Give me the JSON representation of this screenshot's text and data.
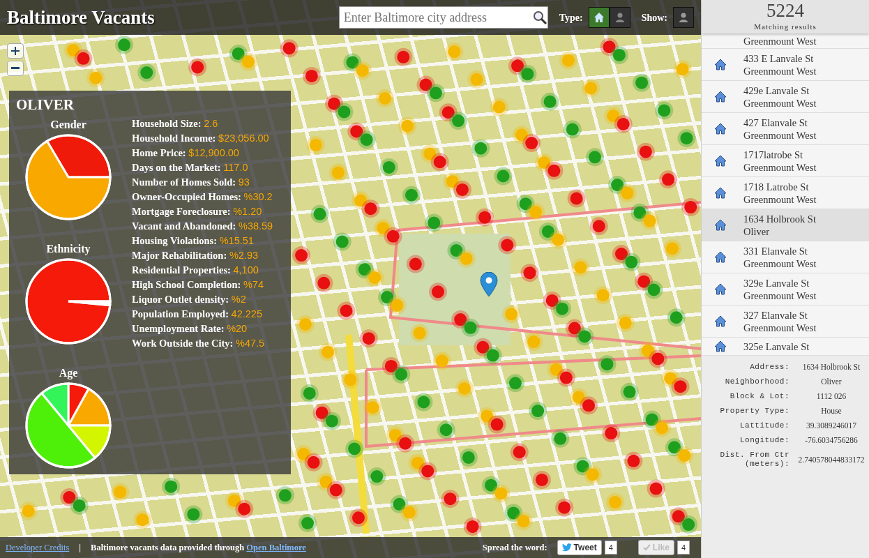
{
  "header": {
    "title": "Baltimore Vacants",
    "search": {
      "placeholder": "Enter Baltimore city address"
    },
    "type_label": "Type:",
    "type_options": [
      {
        "kind": "house",
        "selected": true
      },
      {
        "kind": "person",
        "selected": false
      }
    ],
    "show_label": "Show:"
  },
  "neighborhood_panel": {
    "title": "OLIVER",
    "charts": [
      {
        "title": "Gender",
        "kind": "gender"
      },
      {
        "title": "Ethnicity",
        "kind": "ethnicity"
      },
      {
        "title": "Age",
        "kind": "age"
      }
    ],
    "stats": [
      {
        "label": "Household Size:",
        "value": "2.6"
      },
      {
        "label": "Household Income:",
        "value": "$23,056.00"
      },
      {
        "label": "Home Price:",
        "value": "$12,900.00"
      },
      {
        "label": "Days on the Market:",
        "value": "117.0"
      },
      {
        "label": "Number of Homes Sold:",
        "value": "93"
      },
      {
        "label": "Owner-Occupied Homes:",
        "value": "%30.2"
      },
      {
        "label": "Mortgage Foreclosure:",
        "value": "%1.20"
      },
      {
        "label": "Vacant and Abandoned:",
        "value": "%38.59"
      },
      {
        "label": "Housing Violations:",
        "value": "%15.51"
      },
      {
        "label": "Major Rehabilitation:",
        "value": "%2.93"
      },
      {
        "label": "Residential Properties:",
        "value": "4,100"
      },
      {
        "label": "High School Completion:",
        "value": "%74"
      },
      {
        "label": "Liquor Outlet density:",
        "value": "%2"
      },
      {
        "label": "Population Employed:",
        "value": "42.225"
      },
      {
        "label": "Unemployment Rate:",
        "value": "%20"
      },
      {
        "label": "Work Outside the City:",
        "value": "%47.5"
      }
    ]
  },
  "results": {
    "count": "5224",
    "caption": "Matching results",
    "items": [
      {
        "neighborhood": "Greenmount West",
        "selected": false
      },
      {
        "address": "433 E Lanvale St",
        "neighborhood": "Greenmount West",
        "selected": false
      },
      {
        "address": "429e Lanvale St",
        "neighborhood": "Greenmount West",
        "selected": false
      },
      {
        "address": "427 Elanvale St",
        "neighborhood": "Greenmount West",
        "selected": false
      },
      {
        "address": "1717latrobe St",
        "neighborhood": "Greenmount West",
        "selected": false
      },
      {
        "address": "1718 Latrobe St",
        "neighborhood": "Greenmount West",
        "selected": false
      },
      {
        "address": "1634 Holbrook St",
        "neighborhood": "Oliver",
        "selected": true
      },
      {
        "address": "331 Elanvale St",
        "neighborhood": "Greenmount West",
        "selected": false
      },
      {
        "address": "329e Lanvale St",
        "neighborhood": "Greenmount West",
        "selected": false
      },
      {
        "address": "327 Elanvale St",
        "neighborhood": "Greenmount West",
        "selected": false
      },
      {
        "address": "325e Lanvale St",
        "selected": false
      }
    ]
  },
  "details": [
    {
      "label": "Address:",
      "value": "1634 Holbrook St"
    },
    {
      "label": "Neighborhood:",
      "value": "Oliver"
    },
    {
      "label": "Block & Lot:",
      "value": "1112 026"
    },
    {
      "label": "Property Type:",
      "value": "House"
    },
    {
      "label": "Lattitude:",
      "value": "39.3089246017"
    },
    {
      "label": "Longitude:",
      "value": "-76.6034756286"
    },
    {
      "label": "Dist. From Ctr (meters):",
      "value": "2.740578044833172"
    }
  ],
  "footer": {
    "credits_link": "Developer Credits",
    "separator": "|",
    "data_text": "Baltimore vacants data provided through",
    "data_link": "Open Baltimore",
    "share_label": "Spread the word:",
    "tweet": {
      "label": "Tweet",
      "count": "4"
    },
    "like": {
      "label": "Like",
      "count": "4",
      "disabled": true
    }
  }
}
